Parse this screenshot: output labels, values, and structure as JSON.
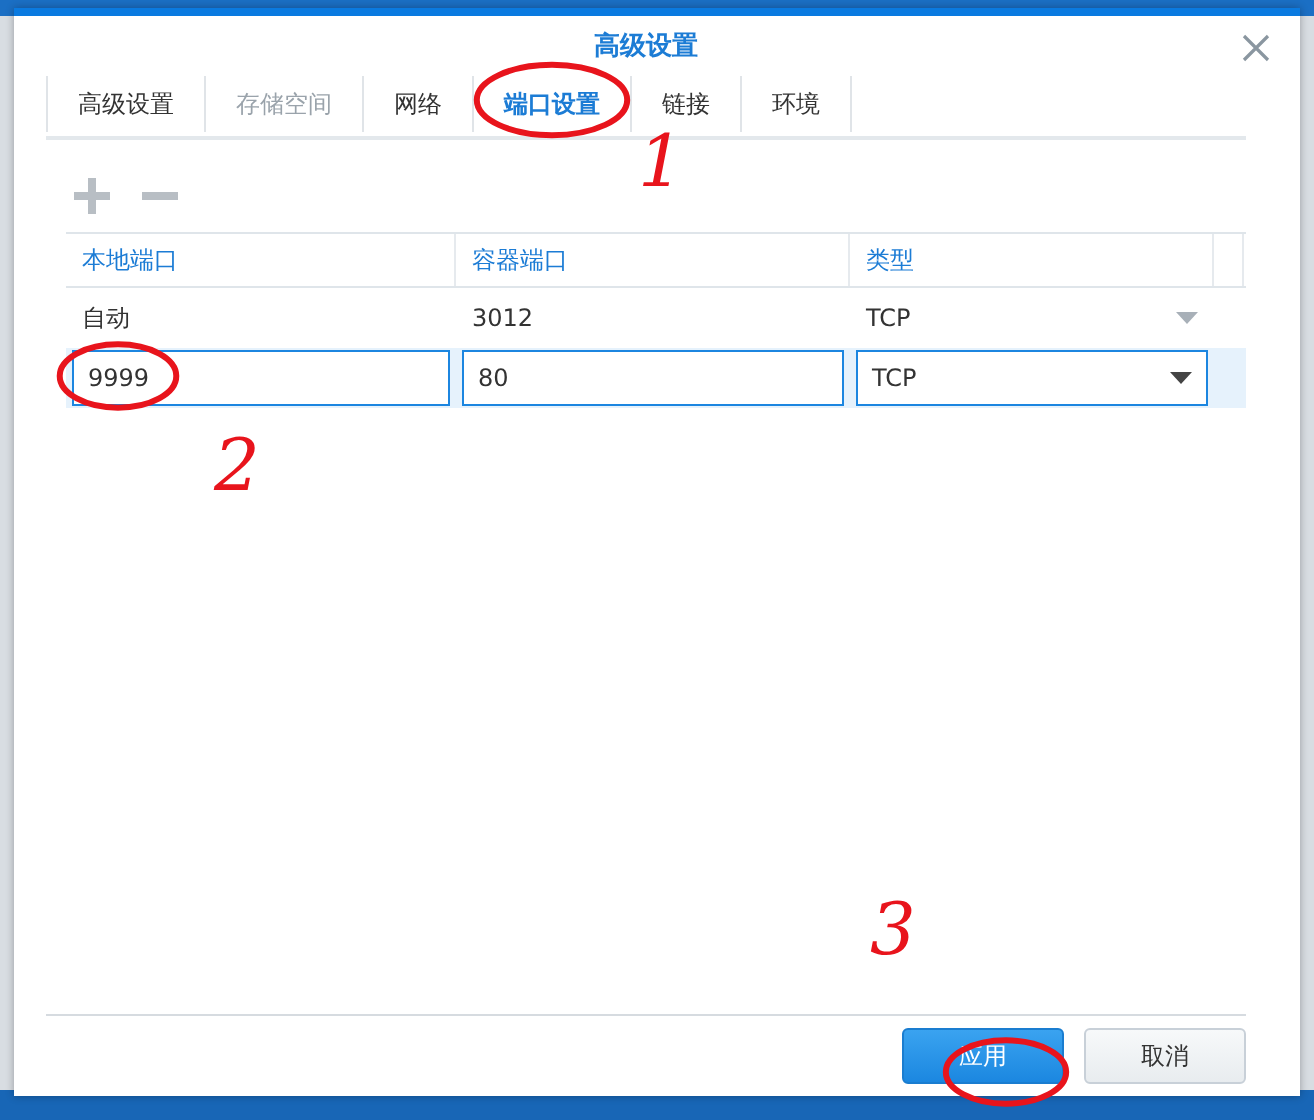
{
  "window": {
    "title": "高级设置"
  },
  "tabs": [
    {
      "label": "高级设置",
      "selected": false,
      "disabled": false
    },
    {
      "label": "存储空间",
      "selected": false,
      "disabled": true
    },
    {
      "label": "网络",
      "selected": false,
      "disabled": false
    },
    {
      "label": "端口设置",
      "selected": true,
      "disabled": false
    },
    {
      "label": "链接",
      "selected": false,
      "disabled": false
    },
    {
      "label": "环境",
      "selected": false,
      "disabled": false
    }
  ],
  "table": {
    "columns": [
      "本地端口",
      "容器端口",
      "类型"
    ],
    "rows": [
      {
        "kind": "text",
        "selected": false,
        "cells": [
          "自动",
          "3012",
          "TCP"
        ]
      },
      {
        "kind": "edit",
        "selected": true,
        "cells": [
          "9999",
          "80",
          "TCP"
        ]
      }
    ]
  },
  "buttons": [
    {
      "label": "应用",
      "kind": "primary"
    },
    {
      "label": "取消",
      "kind": "secondary"
    }
  ],
  "annotations": [
    {
      "label": "1"
    },
    {
      "label": "2"
    },
    {
      "label": "3"
    }
  ]
}
